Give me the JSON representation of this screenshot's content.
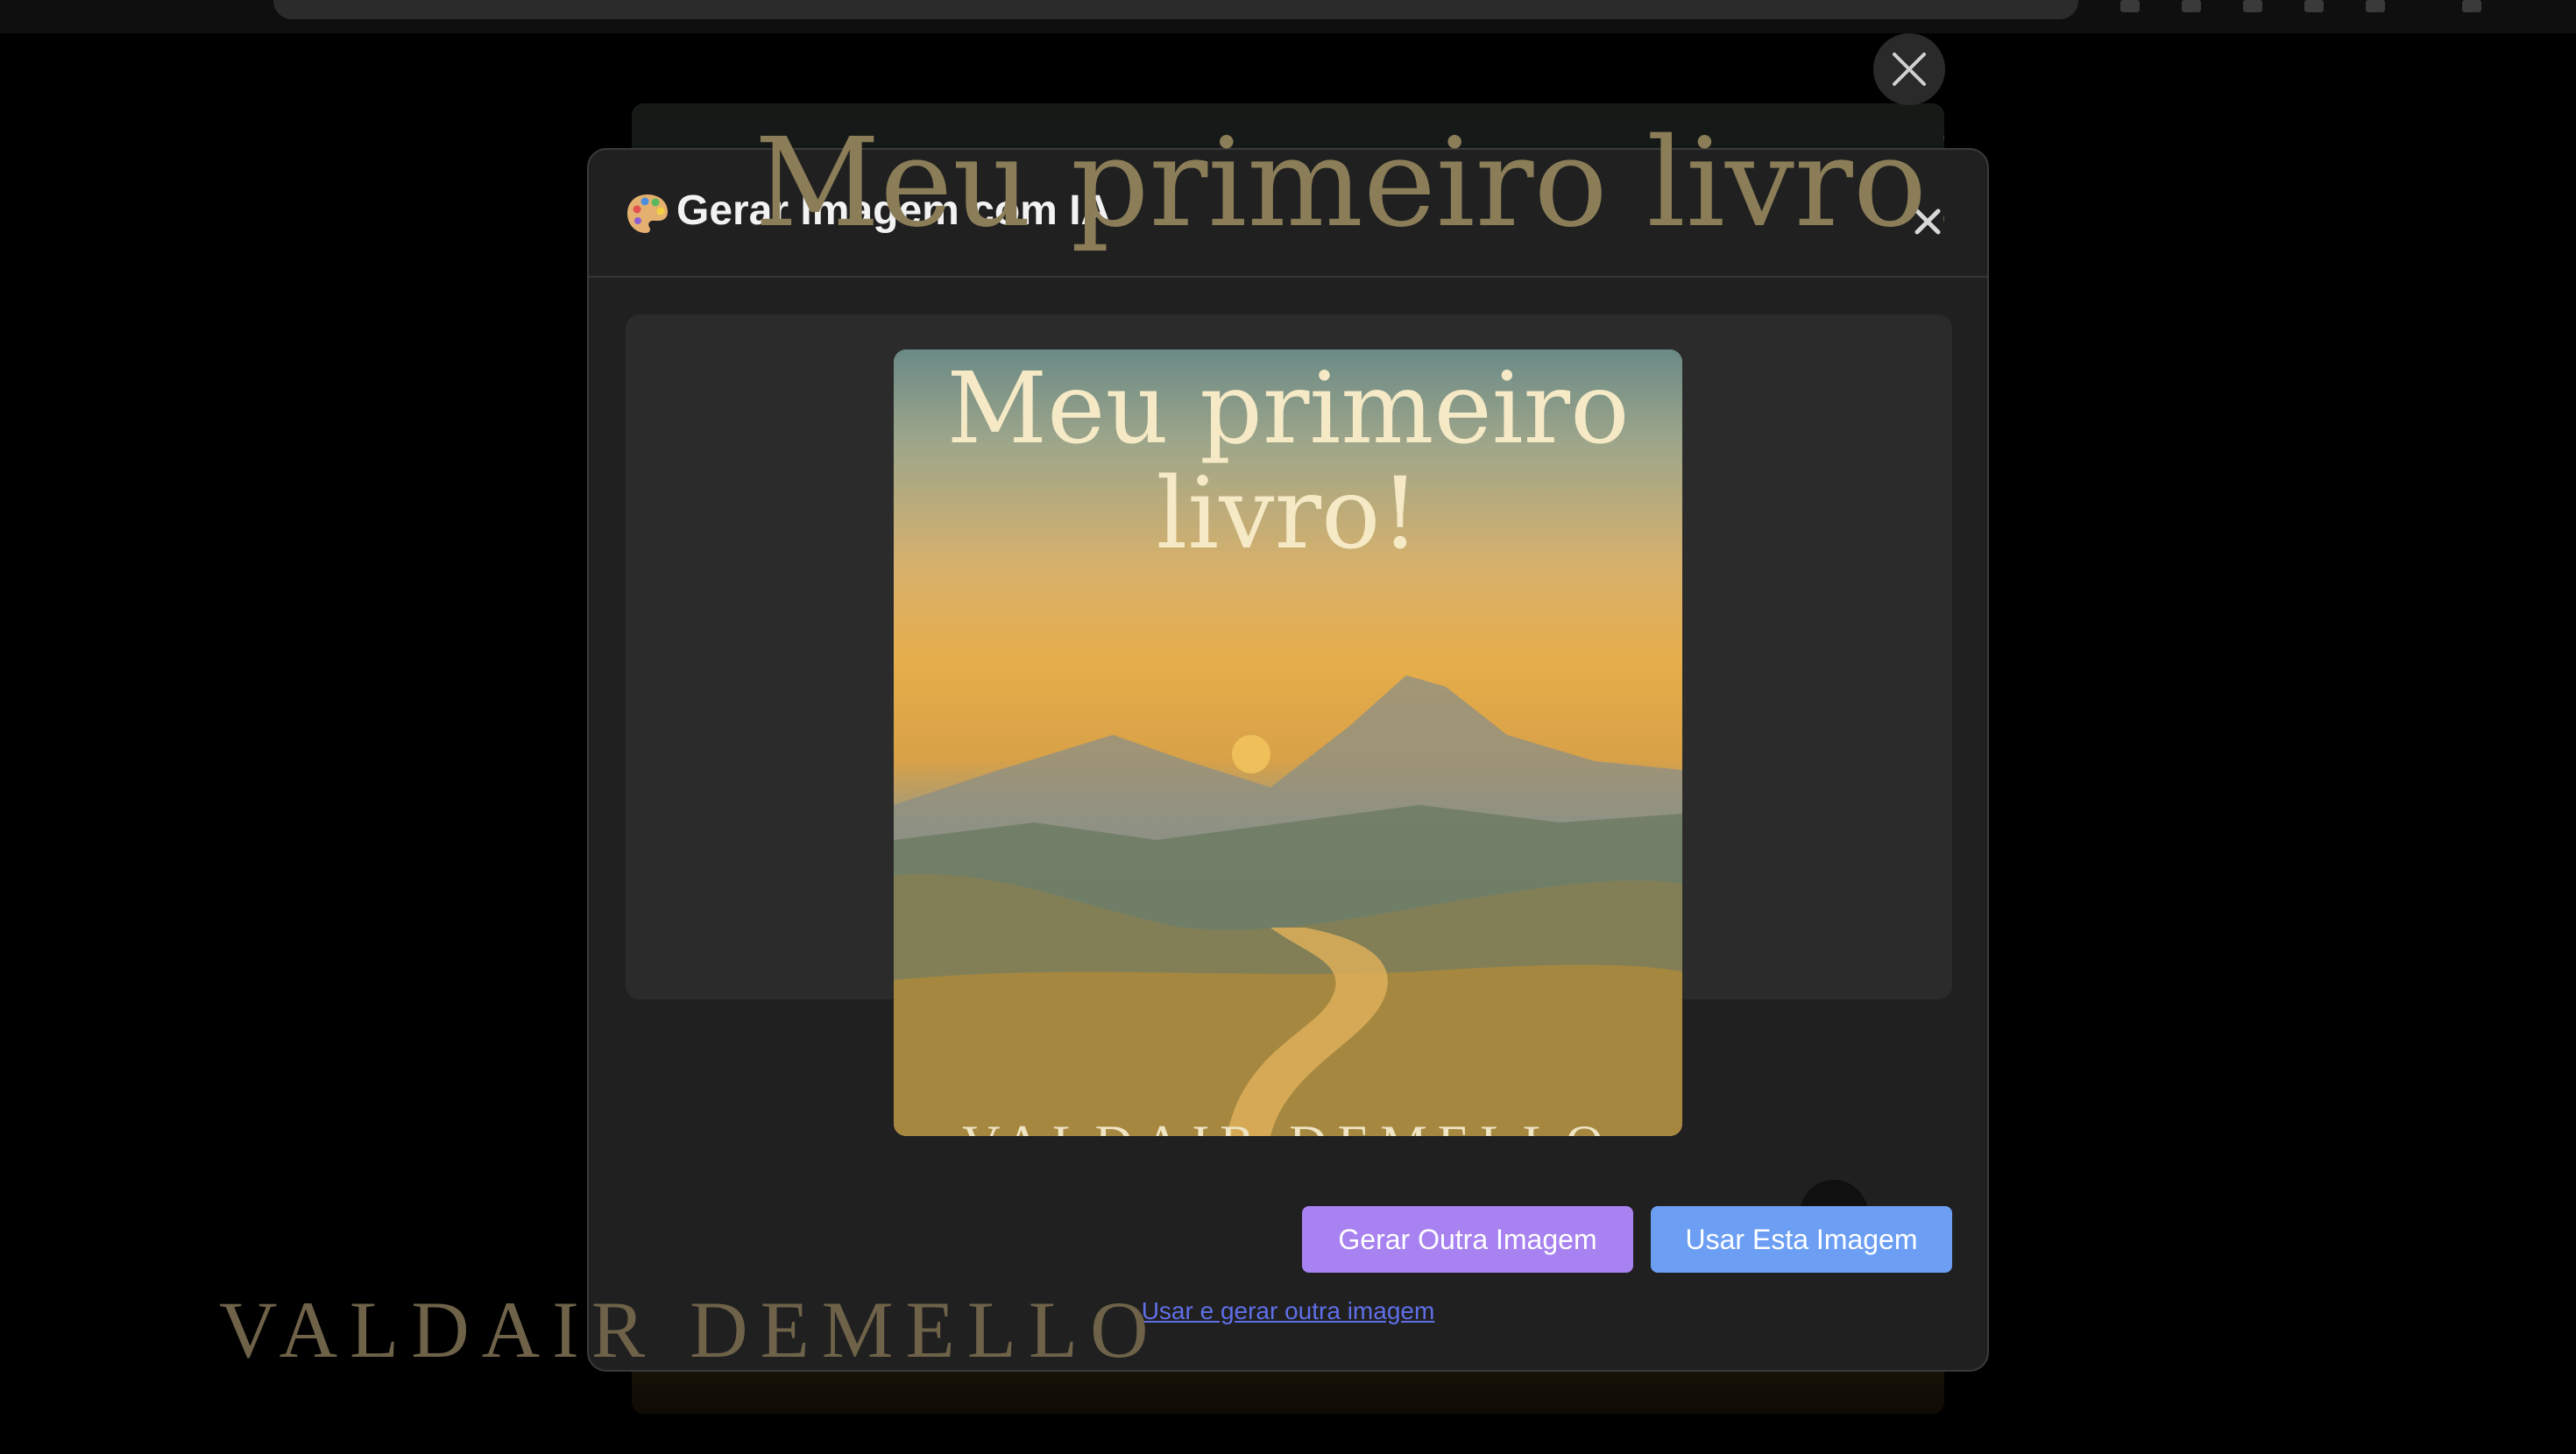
{
  "background": {
    "cover_title": "Meu primeiro livro!",
    "cover_author": "VALDAIR DEMELLO"
  },
  "modal": {
    "icon": "palette-icon",
    "title": "Gerar Imagem com IA",
    "close_icon": "close-icon"
  },
  "preview": {
    "cover_title_line1": "Meu primeiro",
    "cover_title_line2": "livro!",
    "cover_author": "VALDAIR DEMELLO",
    "zoom_icon": "magnifier-icon"
  },
  "actions": {
    "generate_another": "Gerar Outra Imagem",
    "use_this": "Usar Esta Imagem",
    "use_and_generate": "Usar e gerar outra imagem"
  },
  "colors": {
    "generate_button": "#a782f0",
    "use_button": "#6c9ff4",
    "link": "#5f6fe8",
    "modal_bg": "#202020"
  }
}
